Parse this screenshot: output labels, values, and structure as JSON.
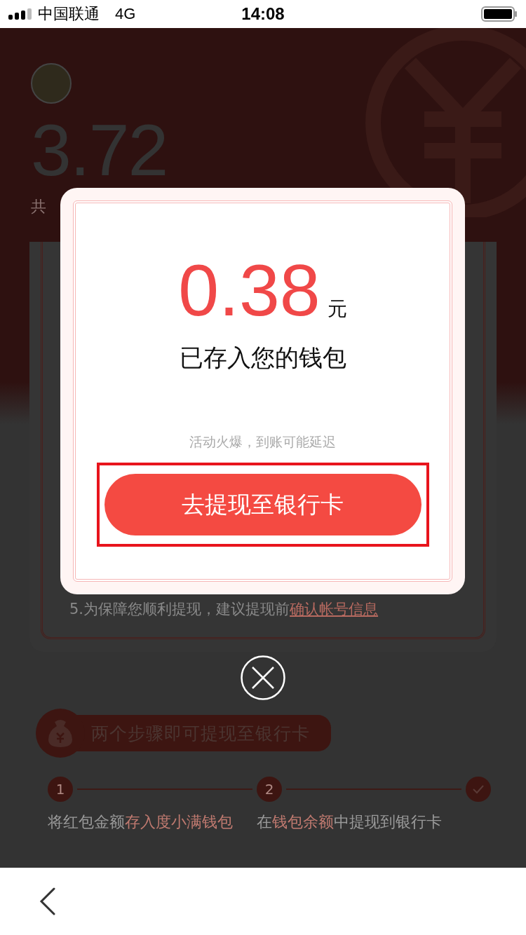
{
  "status_bar": {
    "carrier": "中国联通",
    "network": "4G",
    "time": "14:08"
  },
  "header": {
    "amount": "3.72",
    "caption": "共"
  },
  "notice": {
    "text": "5.为保障您顺利提现，建议提现前",
    "link": "确认帐号信息"
  },
  "steps_banner": {
    "title": "两个步骤即可提现至银行卡"
  },
  "steps": [
    {
      "kind": "number",
      "number": "1",
      "prefix": "将红包金额",
      "highlight": "存入度小满钱包"
    },
    {
      "kind": "number",
      "number": "2",
      "prefix": "在",
      "highlight": "钱包余额",
      "suffix": "中提现到银行卡"
    },
    {
      "kind": "check"
    }
  ],
  "dialog": {
    "amount": "0.38",
    "unit": "元",
    "message": "已存入您的钱包",
    "hint": "活动火爆，到账可能延迟",
    "button": "去提现至银行卡",
    "button_highlighted": true
  }
}
